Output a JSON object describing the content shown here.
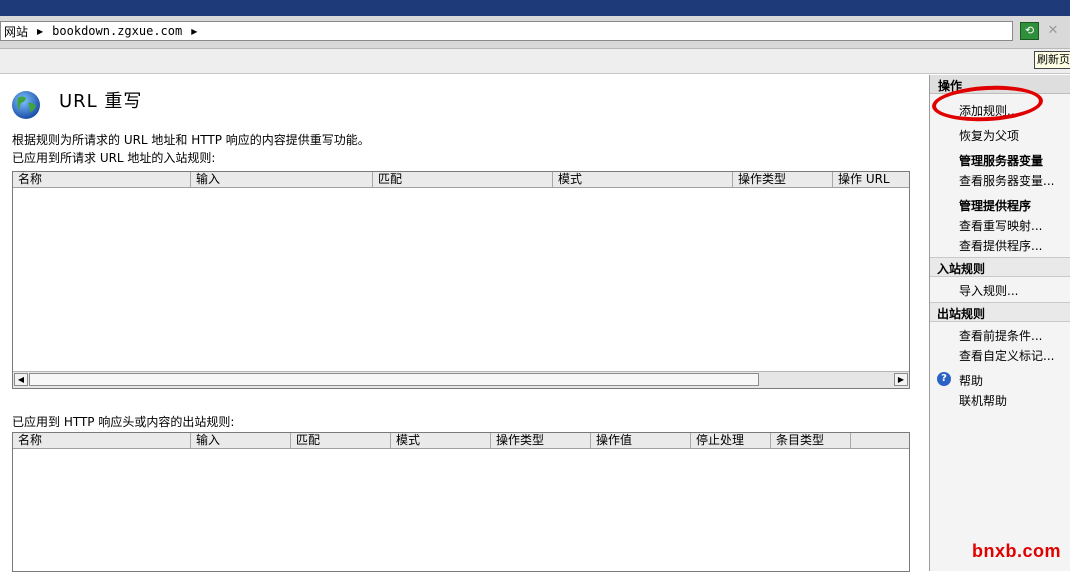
{
  "address_bar": {
    "crumbs": [
      "网站",
      "bookdown.zgxue.com"
    ],
    "go_icon": "refresh-arrows-icon",
    "stop_icon": "close-icon"
  },
  "toolbar": {
    "refresh_tooltip": "刷新页"
  },
  "page": {
    "title": "URL 重写",
    "description": "根据规则为所请求的 URL 地址和 HTTP 响应的内容提供重写功能。",
    "icon": "globe-icon"
  },
  "inbound": {
    "label": "已应用到所请求 URL 地址的入站规则:",
    "columns": [
      "名称",
      "输入",
      "匹配",
      "模式",
      "操作类型",
      "操作 URL"
    ],
    "rows": []
  },
  "outbound": {
    "label": "已应用到 HTTP 响应头或内容的出站规则:",
    "columns": [
      "名称",
      "输入",
      "匹配",
      "模式",
      "操作类型",
      "操作值",
      "停止处理",
      "条目类型"
    ],
    "rows": []
  },
  "actions": {
    "header": "操作",
    "add_rule": "添加规则...",
    "revert_parent": "恢复为父项",
    "group_server_vars": "管理服务器变量",
    "view_server_vars": "查看服务器变量...",
    "group_providers": "管理提供程序",
    "view_rewrite_maps": "查看重写映射...",
    "view_providers": "查看提供程序...",
    "inbound_section": "入站规则",
    "import_rules": "导入规则...",
    "outbound_section": "出站规则",
    "view_preconditions": "查看前提条件...",
    "view_custom_tags": "查看自定义标记...",
    "help": "帮助",
    "online_help": "联机帮助"
  },
  "annotation": {
    "highlight_color": "#e00000"
  },
  "watermark": "bnxb.com"
}
